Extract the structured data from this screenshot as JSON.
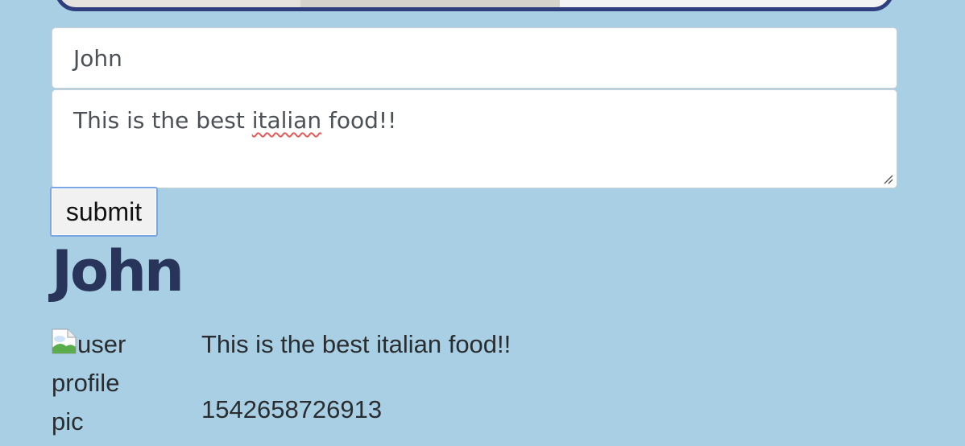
{
  "form": {
    "name_value": "John",
    "review_prefix": "This is the best ",
    "review_misspelled": "italian",
    "review_suffix": " food!!",
    "submit_label": "submit"
  },
  "review": {
    "author": "John",
    "image_alt_line1": "user",
    "image_alt_line2": "profile",
    "image_alt_line3": "pic",
    "text": "This is the best italian food!!",
    "timestamp": "1542658726913"
  },
  "colors": {
    "background": "#a9cfe4",
    "author_heading": "#283459",
    "submit_focus_ring": "#7aa6e6"
  }
}
